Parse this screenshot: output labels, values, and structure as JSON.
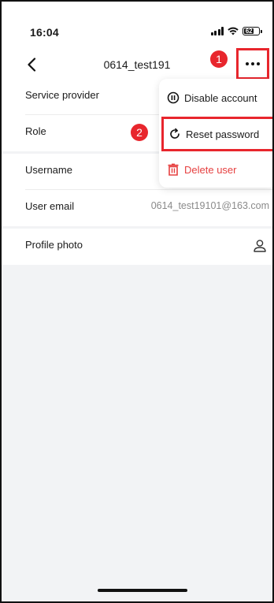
{
  "status_bar": {
    "time": "16:04",
    "battery": "62"
  },
  "nav": {
    "title": "0614_test191"
  },
  "steps": {
    "first": "1",
    "second": "2"
  },
  "details": {
    "group1": [
      {
        "label": "Service provider",
        "value": ""
      },
      {
        "label": "Role",
        "value": ""
      }
    ],
    "group2": [
      {
        "label": "Username",
        "value": ""
      },
      {
        "label": "User email",
        "value": "0614_test19101@163.com"
      }
    ],
    "group3": [
      {
        "label": "Profile photo",
        "icon": "person-icon"
      }
    ]
  },
  "menu": {
    "items": [
      {
        "label": "Disable account",
        "icon": "pause-circle-icon"
      },
      {
        "label": "Reset password",
        "icon": "refresh-icon"
      },
      {
        "label": "Delete user",
        "icon": "trash-icon"
      }
    ]
  },
  "colors": {
    "accent_red": "#e8262d",
    "danger_text": "#e64040",
    "background": "#f2f3f5"
  }
}
